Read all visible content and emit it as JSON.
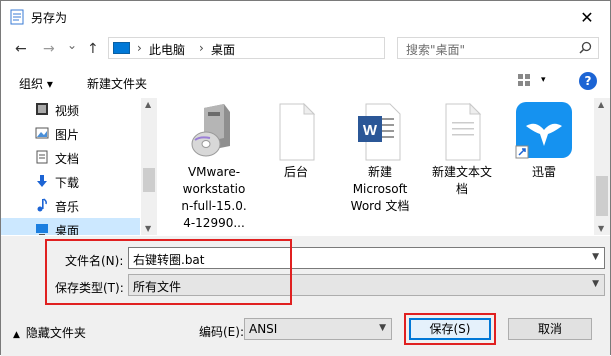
{
  "window": {
    "title": "另存为",
    "close_label": "✕"
  },
  "nav": {
    "back": "←",
    "forward": "→",
    "recent": "⌄",
    "up": "↑",
    "breadcrumb": [
      "此电脑",
      "桌面"
    ],
    "refresh": "↻",
    "search_placeholder": "搜索\"桌面\"",
    "search_icon": "search-icon"
  },
  "toolbar": {
    "organize": "组织 ▾",
    "new_folder": "新建文件夹",
    "view_dd": "▾",
    "help": "?"
  },
  "sidebar": {
    "items": [
      {
        "label": "视频",
        "icon": "video-icon"
      },
      {
        "label": "图片",
        "icon": "pictures-icon"
      },
      {
        "label": "文档",
        "icon": "documents-icon"
      },
      {
        "label": "下载",
        "icon": "download-icon"
      },
      {
        "label": "音乐",
        "icon": "music-icon"
      },
      {
        "label": "桌面",
        "icon": "desktop-icon",
        "selected": true
      }
    ]
  },
  "files": [
    {
      "name": "VMware-workstation-full-15.0.4-12990...",
      "lines": [
        "VMware-",
        "workstatio",
        "n-full-15.0.",
        "4-12990..."
      ],
      "icon": "installer-icon"
    },
    {
      "name": "后台",
      "lines": [
        "后台"
      ],
      "icon": "blank-file-icon"
    },
    {
      "name": "新建 Microsoft Word 文档",
      "lines": [
        "新建",
        "Microsoft",
        "Word 文档"
      ],
      "icon": "word-icon"
    },
    {
      "name": "新建文本文档",
      "lines": [
        "新建文本文",
        "档"
      ],
      "icon": "text-file-icon"
    },
    {
      "name": "迅雷",
      "lines": [
        "迅雷"
      ],
      "icon": "xunlei-icon"
    }
  ],
  "form": {
    "filename_label": "文件名(N):",
    "filename_value": "右键转圈.bat",
    "filetype_label": "保存类型(T):",
    "filetype_value": "所有文件",
    "encoding_label": "编码(E):",
    "encoding_value": "ANSI",
    "save": "保存(S)",
    "cancel": "取消",
    "hide_folders": "隐藏文件夹",
    "hide_caret": "▲"
  },
  "colors": {
    "accent": "#0078d7",
    "highlight": "#e02020",
    "selected": "#cce8ff"
  }
}
